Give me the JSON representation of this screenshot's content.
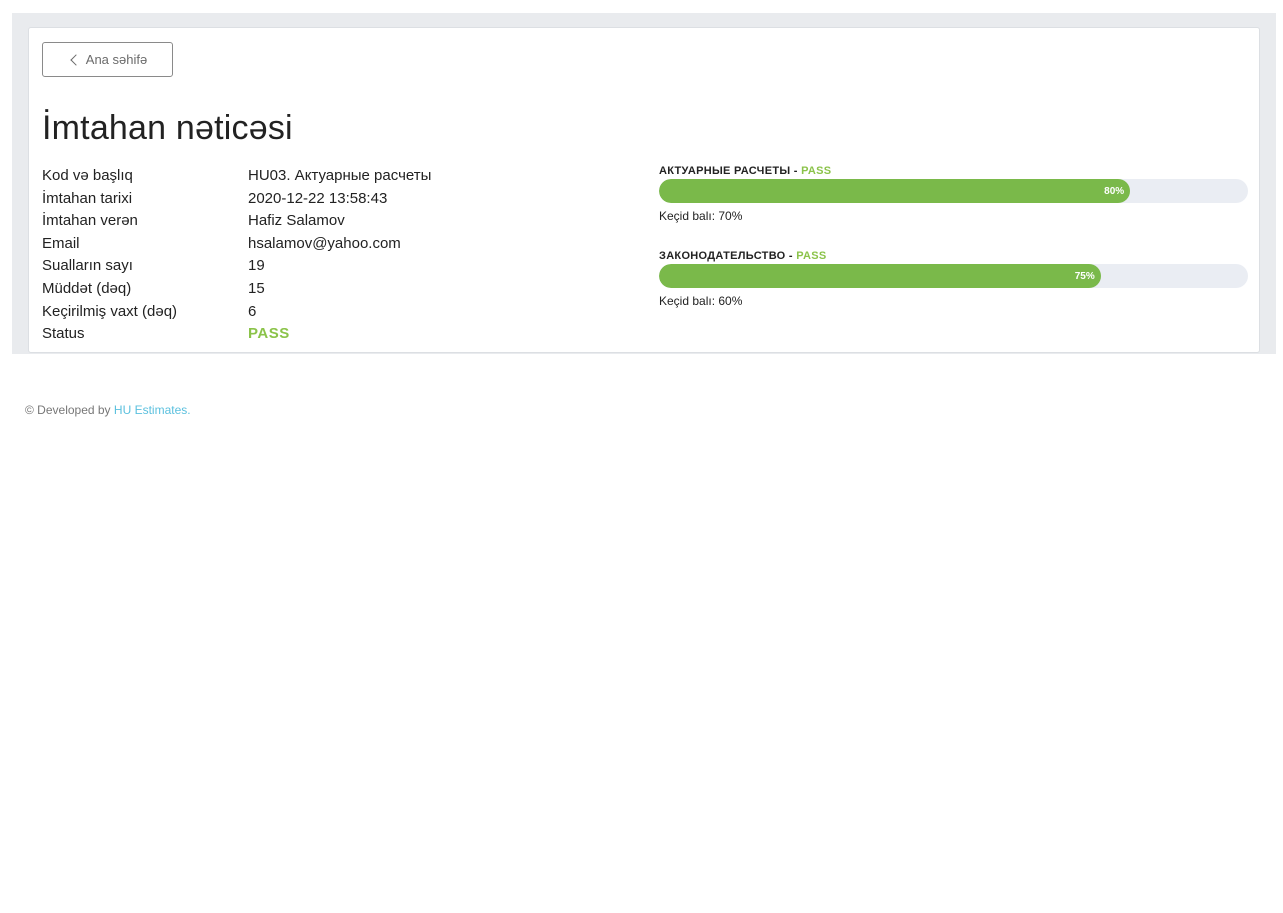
{
  "back_button": {
    "label": "Ana səhifə"
  },
  "page_title": "İmtahan nəticəsi",
  "info": [
    {
      "label": "Kod və başlıq",
      "value": "HU03. Актуарные расчеты"
    },
    {
      "label": "İmtahan tarixi",
      "value": "2020-12-22 13:58:43"
    },
    {
      "label": "İmtahan verən",
      "value": "Hafiz Salamov"
    },
    {
      "label": "Email",
      "value": "hsalamov@yahoo.com"
    },
    {
      "label": "Sualların sayı",
      "value": "19"
    },
    {
      "label": "Müddət (dəq)",
      "value": "15"
    },
    {
      "label": "Keçirilmiş vaxt (dəq)",
      "value": "6"
    },
    {
      "label": "Status",
      "value": "PASS"
    }
  ],
  "results": [
    {
      "name": "АКТУАРНЫЕ РАСЧЕТЫ",
      "separator": " - ",
      "status": "PASS",
      "percent": 80,
      "percent_label": "80%",
      "pass_mark": "Keçid balı: 70%"
    },
    {
      "name": "ЗАКОНОДАТЕЛЬСТВО",
      "separator": " - ",
      "status": "PASS",
      "percent": 75,
      "percent_label": "75%",
      "pass_mark": "Keçid balı: 60%"
    }
  ],
  "footer": {
    "prefix": "© Developed by ",
    "link_text": "HU Estimates."
  },
  "colors": {
    "pass": "#8bc34a",
    "bar_fill": "#7ab94a",
    "bar_track": "#eaedf3",
    "link": "#5bc0de"
  }
}
